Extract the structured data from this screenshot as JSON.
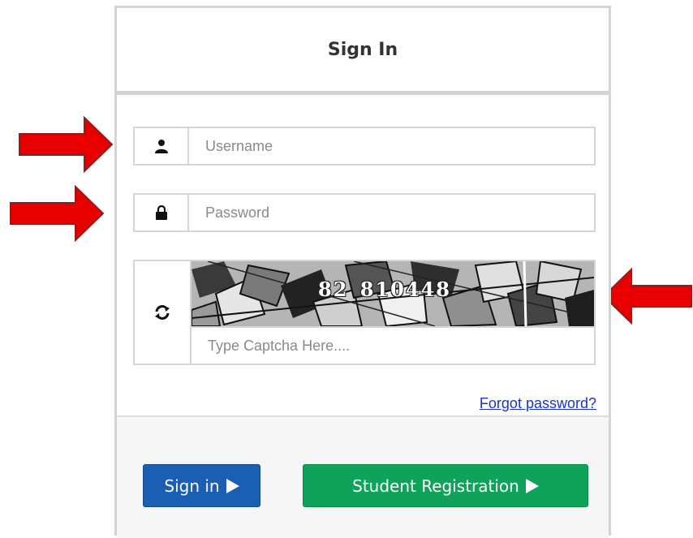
{
  "header": {
    "title": "Sign In"
  },
  "form": {
    "username": {
      "placeholder": "Username",
      "value": "",
      "icon": "user-icon"
    },
    "password": {
      "placeholder": "Password",
      "value": "",
      "icon": "lock-icon"
    },
    "captcha": {
      "code": "82 810448",
      "placeholder": "Type Captcha Here....",
      "value": "",
      "refresh_icon": "refresh-icon"
    },
    "forgot_password": "Forgot password?"
  },
  "footer": {
    "signin_label": "Sign in",
    "register_label": "Student Registration"
  },
  "colors": {
    "signin_button": "#1a5fb4",
    "register_button": "#0fa25a",
    "link": "#1a33cc",
    "annotation_arrow": "#e80000"
  }
}
